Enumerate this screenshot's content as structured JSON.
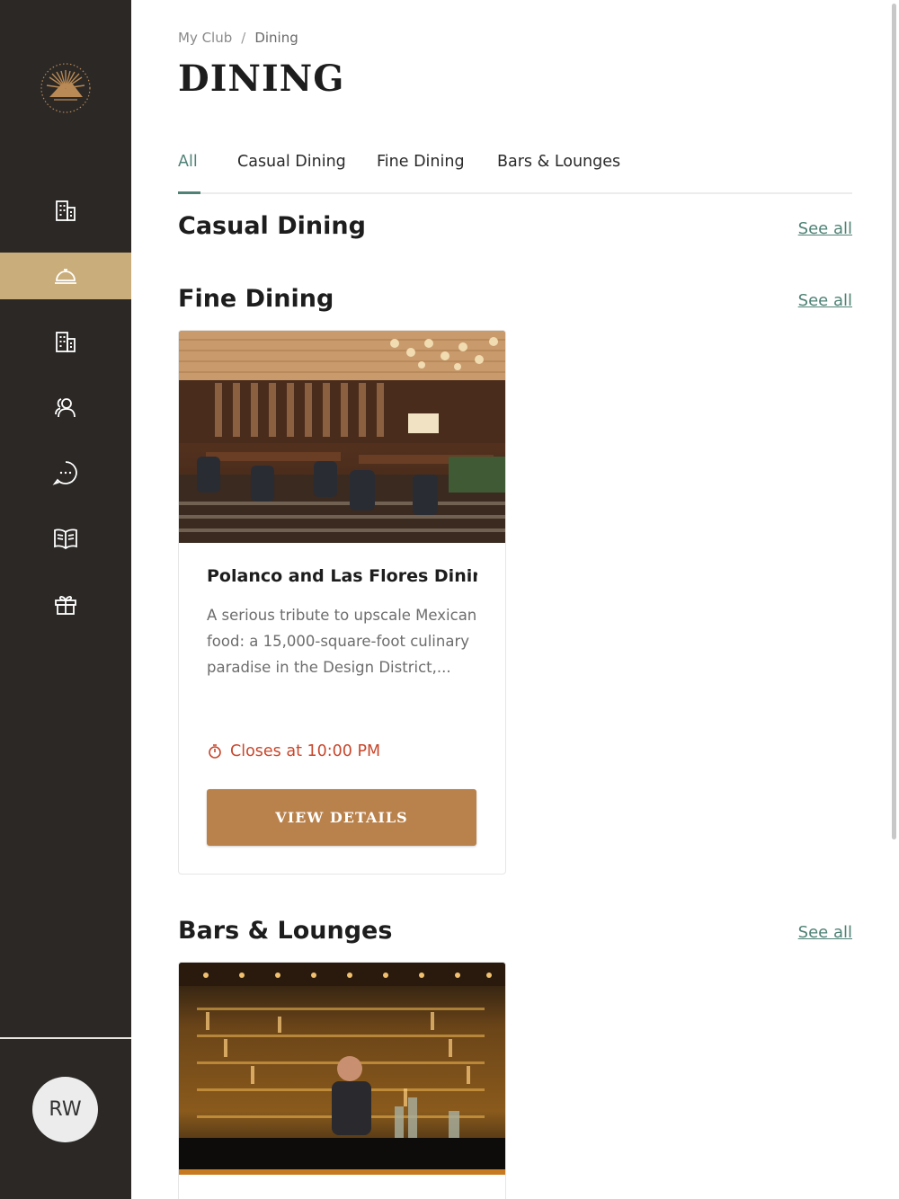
{
  "sidebar": {
    "logo": "club-logo",
    "items": [
      {
        "icon": "building-icon",
        "active": false
      },
      {
        "icon": "dining-cloche-icon",
        "active": true
      },
      {
        "icon": "building-icon",
        "active": false
      },
      {
        "icon": "members-icon",
        "active": false
      },
      {
        "icon": "chat-icon",
        "active": false
      },
      {
        "icon": "book-icon",
        "active": false
      },
      {
        "icon": "gift-icon",
        "active": false
      }
    ],
    "avatar_initials": "RW"
  },
  "breadcrumb": {
    "root": "My Club",
    "separator": "/",
    "current": "Dining"
  },
  "page_title": "DINING",
  "tabs": [
    {
      "label": "All",
      "active": true
    },
    {
      "label": "Casual Dining",
      "active": false
    },
    {
      "label": "Fine Dining",
      "active": false
    },
    {
      "label": "Bars & Lounges",
      "active": false
    }
  ],
  "sections": {
    "casual": {
      "title": "Casual Dining",
      "see_all": "See all"
    },
    "fine": {
      "title": "Fine Dining",
      "see_all": "See all",
      "card": {
        "title": "Polanco and Las Flores Dining Room",
        "description": "A serious tribute to upscale Mexican food: a 15,000-square-foot culinary paradise in the Design District,...",
        "status": "Closes at 10:00 PM",
        "button": "VIEW DETAILS"
      }
    },
    "bars": {
      "title": "Bars & Lounges",
      "see_all": "See all"
    }
  },
  "colors": {
    "sidebar_bg": "#2b2826",
    "active_nav": "#c9ad7a",
    "accent_green": "#4f8275",
    "button_brown": "#b9824c",
    "status_red": "#c8472c"
  }
}
